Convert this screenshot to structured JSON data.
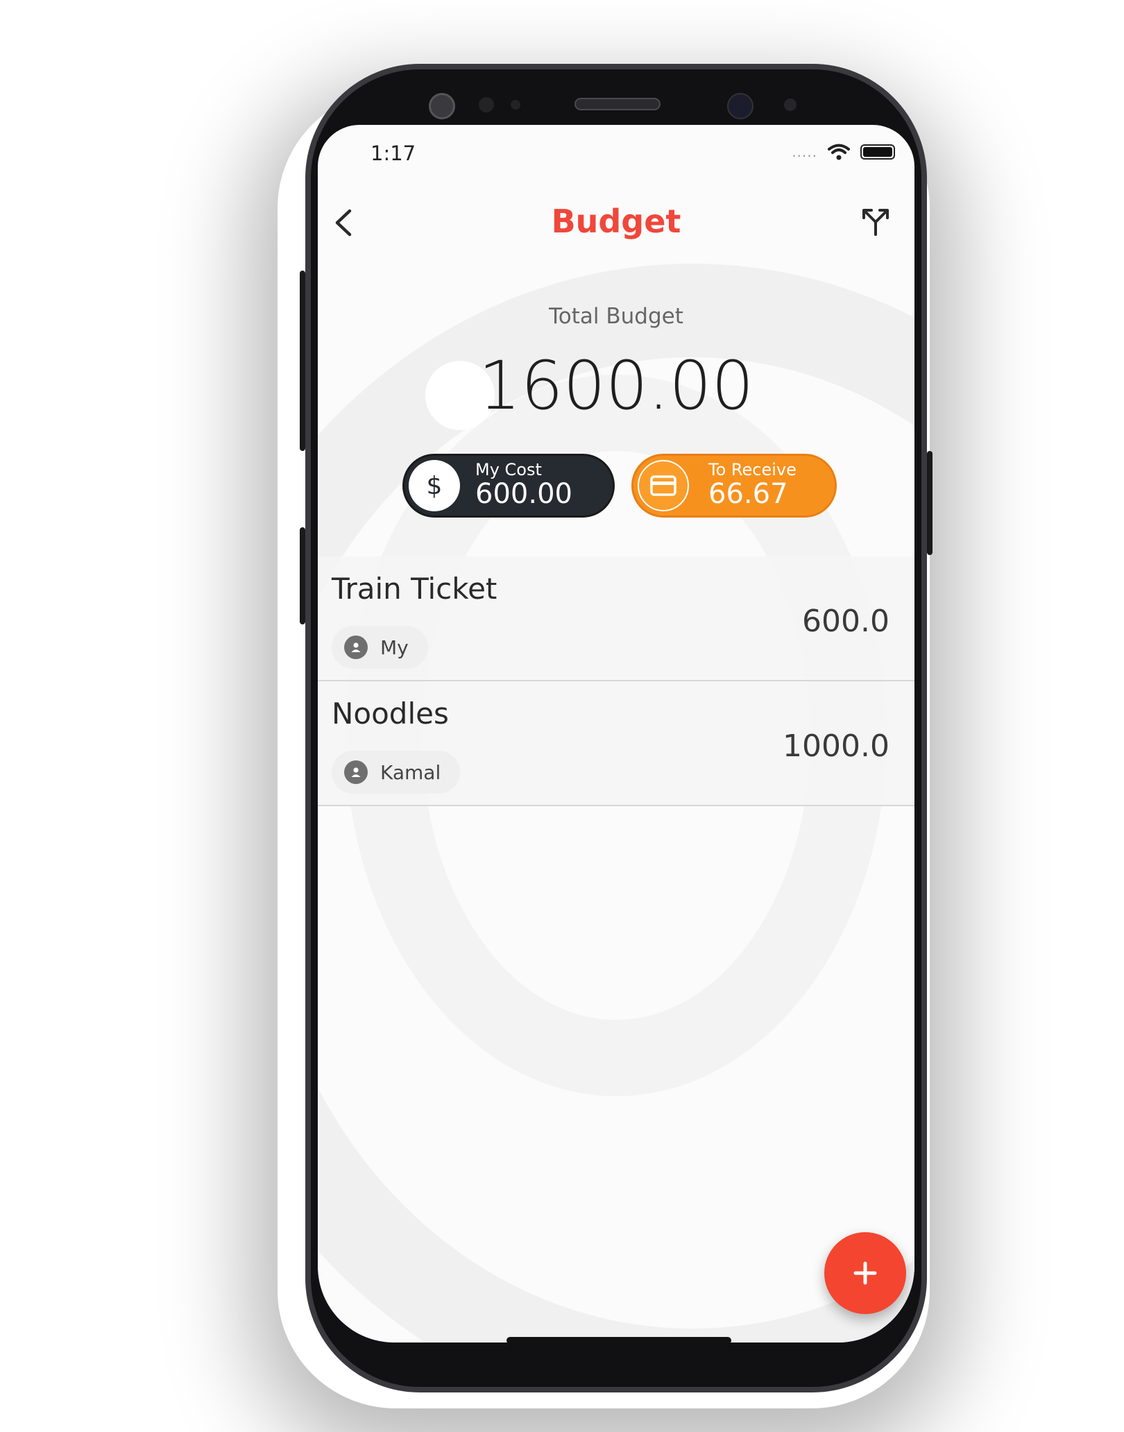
{
  "status_bar": {
    "time": "1:17",
    "signal": "....."
  },
  "header": {
    "title": "Budget",
    "back_icon": "chevron-left-icon",
    "split_icon": "split-arrows-icon"
  },
  "total": {
    "label": "Total Budget",
    "value": "1600.00"
  },
  "summary": {
    "my_cost": {
      "label": "My Cost",
      "value": "600.00",
      "icon": "dollar-icon"
    },
    "to_receive": {
      "label": "To Receive",
      "value": "66.67",
      "icon": "credit-card-icon"
    }
  },
  "expenses": [
    {
      "title": "Train Ticket",
      "payer": "My",
      "amount": "600.0"
    },
    {
      "title": "Noodles",
      "payer": "Kamal",
      "amount": "1000.0"
    }
  ],
  "fab": {
    "icon": "plus-icon",
    "symbol": "+"
  },
  "colors": {
    "accent": "#f0473a",
    "fab": "#f44530",
    "orange": "#f7911e",
    "dark_pill": "#262a31"
  }
}
